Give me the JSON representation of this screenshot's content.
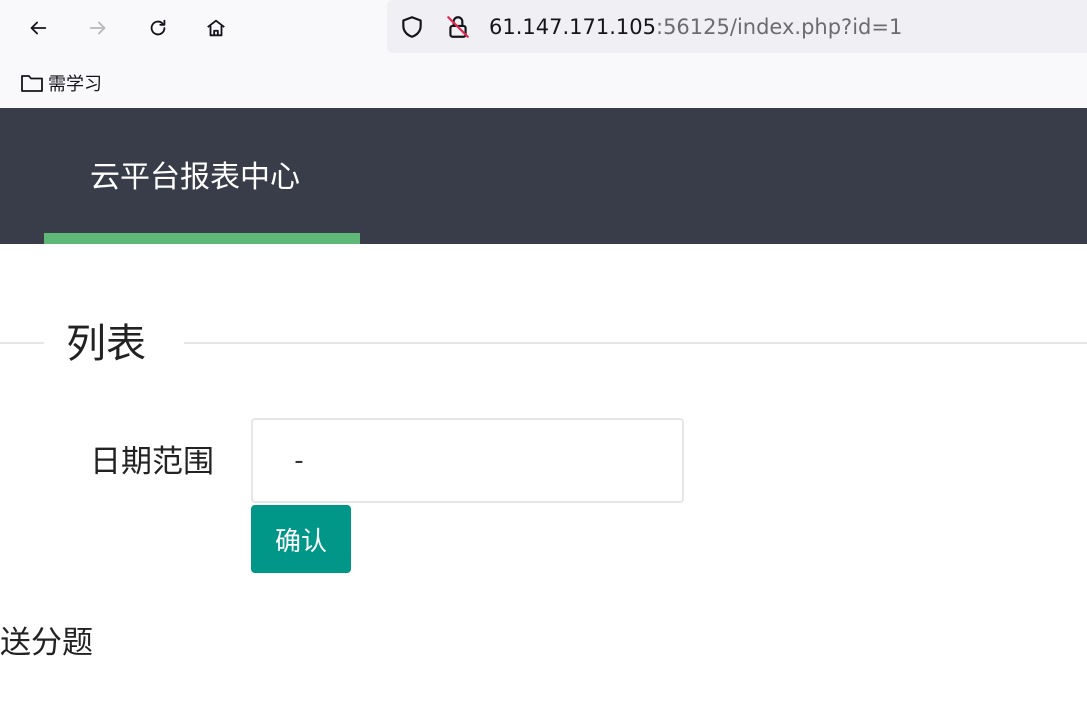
{
  "browser": {
    "url_host": "61.147.171.105",
    "url_rest": ":56125/index.php?id=1",
    "bookmark_label": "需学习"
  },
  "site": {
    "title": "云平台报表中心"
  },
  "section": {
    "legend": "列表"
  },
  "form": {
    "date_label": "日期范围",
    "date_value": " - ",
    "confirm_label": "确认"
  },
  "content": {
    "text": "送分题"
  },
  "colors": {
    "header_bg": "#393d49",
    "accent_green": "#5fb878",
    "button_teal": "#009688"
  }
}
